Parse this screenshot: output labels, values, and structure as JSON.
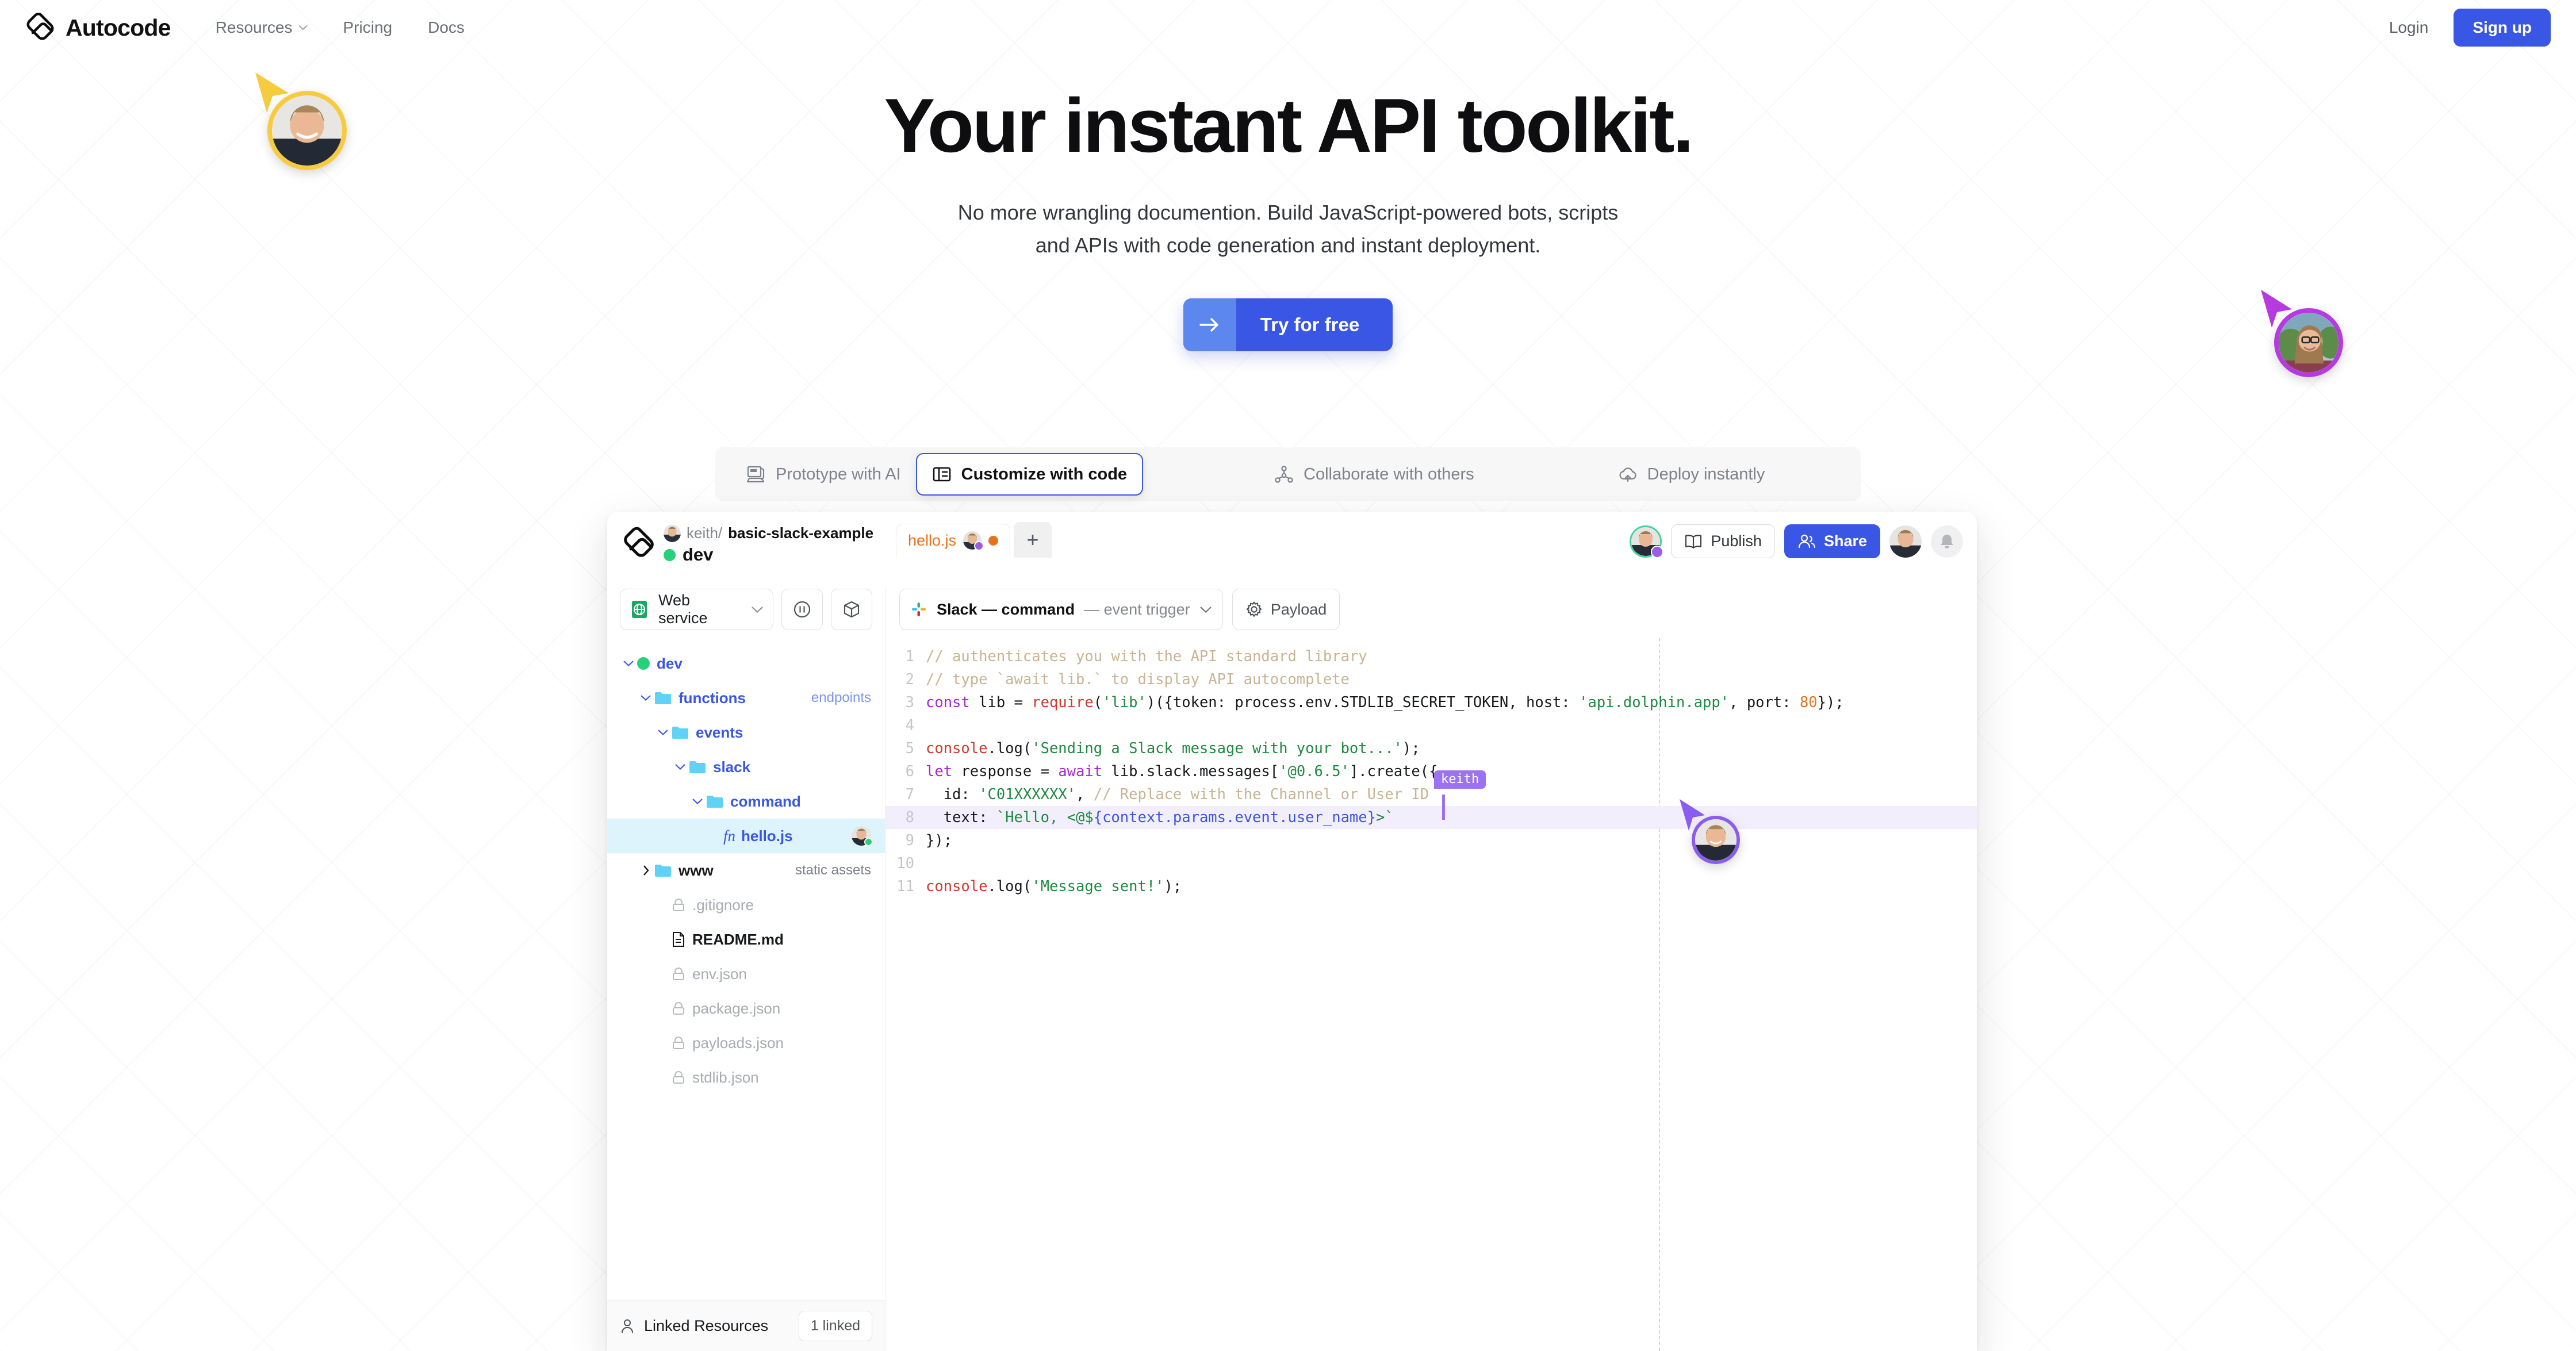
{
  "nav": {
    "brand": "Autocode",
    "brand_logo_icon": "autocode-logo-icon",
    "links": [
      {
        "label": "Resources",
        "has_chevron": true
      },
      {
        "label": "Pricing",
        "has_chevron": false
      },
      {
        "label": "Docs",
        "has_chevron": false
      }
    ],
    "login_label": "Login",
    "signup_label": "Sign up"
  },
  "hero": {
    "title": "Your instant API toolkit.",
    "subtitle_line1": "No more wrangling documention. Build JavaScript-powered bots, scripts",
    "subtitle_line2": "and APIs with code generation and instant deployment.",
    "cta_label": "Try for free",
    "cta_icon": "arrow-right-icon"
  },
  "feature_tabs": [
    {
      "label": "Prototype with AI",
      "icon": "computer-icon",
      "active": false
    },
    {
      "label": "Customize with code",
      "icon": "code-panel-icon",
      "active": true
    },
    {
      "label": "Collaborate with others",
      "icon": "network-icon",
      "active": false
    },
    {
      "label": "Deploy instantly",
      "icon": "cloud-upload-icon",
      "active": false
    }
  ],
  "ide": {
    "logo_icon": "autocode-logo-icon",
    "project_owner": "keith/",
    "project_name": "basic-slack-example",
    "environment": "dev",
    "environment_status_color": "#27d07a",
    "service_select_label": "Web service",
    "service_icon": "green-globe-icon",
    "pause_button_icon": "pause-circle-icon",
    "package_button_icon": "package-box-icon",
    "file_tab": {
      "name": "hello.js",
      "unsaved_dot_color": "#e8721c",
      "collaborator_badge_color": "#9b5de5"
    },
    "new_tab_label": "+",
    "toolbar": {
      "publish_label": "Publish",
      "publish_icon": "book-open-icon",
      "share_label": "Share",
      "share_icon": "users-icon",
      "bell_icon": "bell-icon",
      "avatar_ring_color": "#45d49b"
    },
    "trigger": {
      "icon": "slack-icon",
      "name": "Slack — command",
      "kind": "— event trigger",
      "chevron_icon": "chevron-down-icon",
      "payload_label": "Payload",
      "payload_icon": "gear-icon"
    },
    "file_tree": [
      {
        "depth": 0,
        "label": "dev",
        "style": "blue",
        "twisty": "down",
        "icon": "green-dot",
        "tag": "",
        "tag_style": ""
      },
      {
        "depth": 1,
        "label": "functions",
        "style": "blue",
        "twisty": "down",
        "icon": "folder",
        "tag": "endpoints",
        "tag_style": "blue"
      },
      {
        "depth": 2,
        "label": "events",
        "style": "blue",
        "twisty": "down",
        "icon": "folder",
        "tag": "",
        "tag_style": ""
      },
      {
        "depth": 3,
        "label": "slack",
        "style": "blue",
        "twisty": "down",
        "icon": "folder",
        "tag": "",
        "tag_style": ""
      },
      {
        "depth": 4,
        "label": "command",
        "style": "blue",
        "twisty": "down",
        "icon": "folder",
        "tag": "",
        "tag_style": ""
      },
      {
        "depth": 5,
        "label": "hello.js",
        "style": "blue",
        "twisty": "none",
        "icon": "fn",
        "tag": "avatar",
        "tag_style": "",
        "selected": true
      },
      {
        "depth": 1,
        "label": "www",
        "style": "dark",
        "twisty": "right",
        "icon": "folder",
        "tag": "static assets",
        "tag_style": "gray"
      },
      {
        "depth": 2,
        "label": ".gitignore",
        "style": "muted",
        "twisty": "none",
        "icon": "lock",
        "tag": "",
        "tag_style": ""
      },
      {
        "depth": 2,
        "label": "README.md",
        "style": "dark",
        "twisty": "none",
        "icon": "doc",
        "tag": "",
        "tag_style": ""
      },
      {
        "depth": 2,
        "label": "env.json",
        "style": "muted",
        "twisty": "none",
        "icon": "lock",
        "tag": "",
        "tag_style": ""
      },
      {
        "depth": 2,
        "label": "package.json",
        "style": "muted",
        "twisty": "none",
        "icon": "lock",
        "tag": "",
        "tag_style": ""
      },
      {
        "depth": 2,
        "label": "payloads.json",
        "style": "muted",
        "twisty": "none",
        "icon": "lock",
        "tag": "",
        "tag_style": ""
      },
      {
        "depth": 2,
        "label": "stdlib.json",
        "style": "muted",
        "twisty": "none",
        "icon": "lock",
        "tag": "",
        "tag_style": ""
      }
    ],
    "linked_resources": {
      "icon": "person-icon",
      "label": "Linked Resources",
      "count_label": "1 linked"
    },
    "code": {
      "line_numbers": [
        "1",
        "2",
        "3",
        "4",
        "5",
        "6",
        "7",
        "8",
        "9",
        "10",
        "11"
      ],
      "lines": [
        [
          {
            "t": "// authenticates you with the API standard library",
            "c": "c-com"
          }
        ],
        [
          {
            "t": "// type `await lib.` to display API autocomplete",
            "c": "c-com"
          }
        ],
        [
          {
            "t": "const",
            "c": "c-kw"
          },
          {
            "t": " lib ",
            "c": "c-var"
          },
          {
            "t": "= ",
            "c": "c-var"
          },
          {
            "t": "require",
            "c": "c-fn"
          },
          {
            "t": "(",
            "c": "c-var"
          },
          {
            "t": "'lib'",
            "c": "c-str"
          },
          {
            "t": ")({token: process.env.STDLIB_SECRET_TOKEN, host: ",
            "c": "c-var"
          },
          {
            "t": "'api.dolphin.app'",
            "c": "c-str"
          },
          {
            "t": ", port: ",
            "c": "c-var"
          },
          {
            "t": "80",
            "c": "c-num"
          },
          {
            "t": "});",
            "c": "c-var"
          }
        ],
        [
          {
            "t": "",
            "c": "c-var"
          }
        ],
        [
          {
            "t": "console",
            "c": "c-fn"
          },
          {
            "t": ".log(",
            "c": "c-var"
          },
          {
            "t": "'Sending a Slack message with your bot...'",
            "c": "c-str"
          },
          {
            "t": ");",
            "c": "c-var"
          }
        ],
        [
          {
            "t": "let",
            "c": "c-kw"
          },
          {
            "t": " response = ",
            "c": "c-var"
          },
          {
            "t": "await",
            "c": "c-kw"
          },
          {
            "t": " lib.slack.messages[",
            "c": "c-var"
          },
          {
            "t": "'@0.6.5'",
            "c": "c-str"
          },
          {
            "t": "].create({",
            "c": "c-var"
          }
        ],
        [
          {
            "t": "  id: ",
            "c": "c-var"
          },
          {
            "t": "'C01XXXXXX'",
            "c": "c-str"
          },
          {
            "t": ", ",
            "c": "c-var"
          },
          {
            "t": "// Replace with the Channel or User ID",
            "c": "c-com"
          }
        ],
        [
          {
            "t": "  text: ",
            "c": "c-var"
          },
          {
            "t": "`Hello, <@$",
            "c": "c-str"
          },
          {
            "t": "{context.params.event.user_name}",
            "c": "c-blue"
          },
          {
            "t": ">",
            "c": "c-str"
          },
          {
            "t": "`",
            "c": "c-str"
          }
        ],
        [
          {
            "t": "});",
            "c": "c-var"
          }
        ],
        [
          {
            "t": "",
            "c": "c-var"
          }
        ],
        [
          {
            "t": "console",
            "c": "c-fn"
          },
          {
            "t": ".log(",
            "c": "c-var"
          },
          {
            "t": "'Message sent!'",
            "c": "c-str"
          },
          {
            "t": ");",
            "c": "c-var"
          }
        ]
      ],
      "highlighted_line_index": 7,
      "collaborator_caret_label": "keith",
      "collaborator_caret_color": "#9b72ef"
    }
  },
  "cursors": [
    {
      "name": "keith-top-left",
      "color": "#f7cb3f"
    },
    {
      "name": "purple-right",
      "color": "#b63ae0"
    },
    {
      "name": "purple-editor",
      "color": "#8a5cf0"
    }
  ],
  "colors": {
    "accent_blue": "#3a56e4",
    "light_blue": "#5b87ee",
    "green": "#27d07a",
    "orange": "#e8721c",
    "purple": "#9b5de5"
  }
}
